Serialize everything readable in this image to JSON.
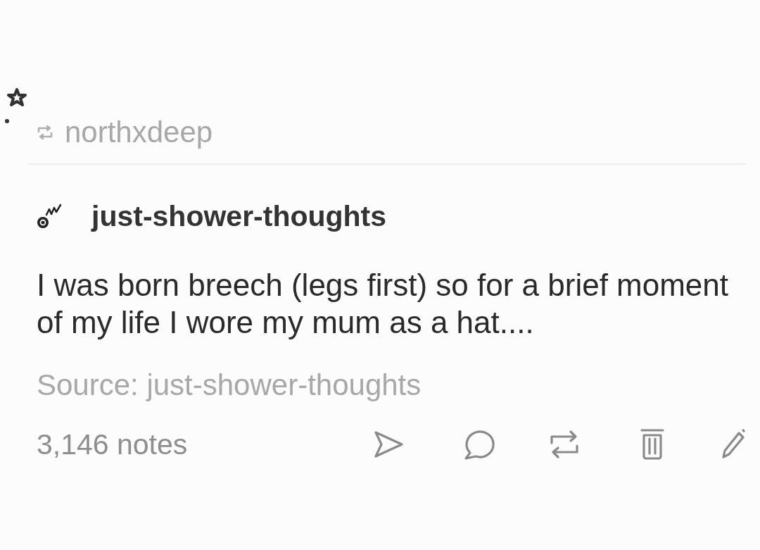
{
  "reblog": {
    "username": "northxdeep"
  },
  "post": {
    "blog_name": "just-shower-thoughts",
    "body": "I was born breech (legs first) so for a brief moment of my life I wore my mum as a hat....",
    "source": "Source: just-shower-thoughts",
    "notes": "3,146 notes"
  },
  "actions": [
    {
      "kind": "share"
    },
    {
      "kind": "reply"
    },
    {
      "kind": "reblog"
    },
    {
      "kind": "delete"
    },
    {
      "kind": "edit"
    }
  ]
}
